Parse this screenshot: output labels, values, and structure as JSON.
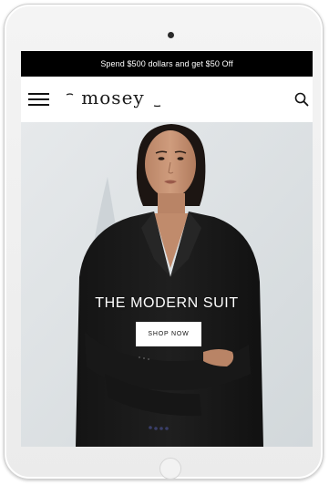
{
  "promo": {
    "text": "Spend $500 dollars and get $50 Off"
  },
  "header": {
    "logo_text": "mosey",
    "menu_icon": "hamburger-menu-icon",
    "search_icon": "search-icon"
  },
  "hero": {
    "title": "THE MODERN SUIT",
    "cta_label": "SHOP NOW"
  },
  "colors": {
    "promo_background": "#000000",
    "promo_text": "#ffffff",
    "hero_background": "#dde1e4",
    "button_background": "#ffffff",
    "button_text": "#111111"
  }
}
